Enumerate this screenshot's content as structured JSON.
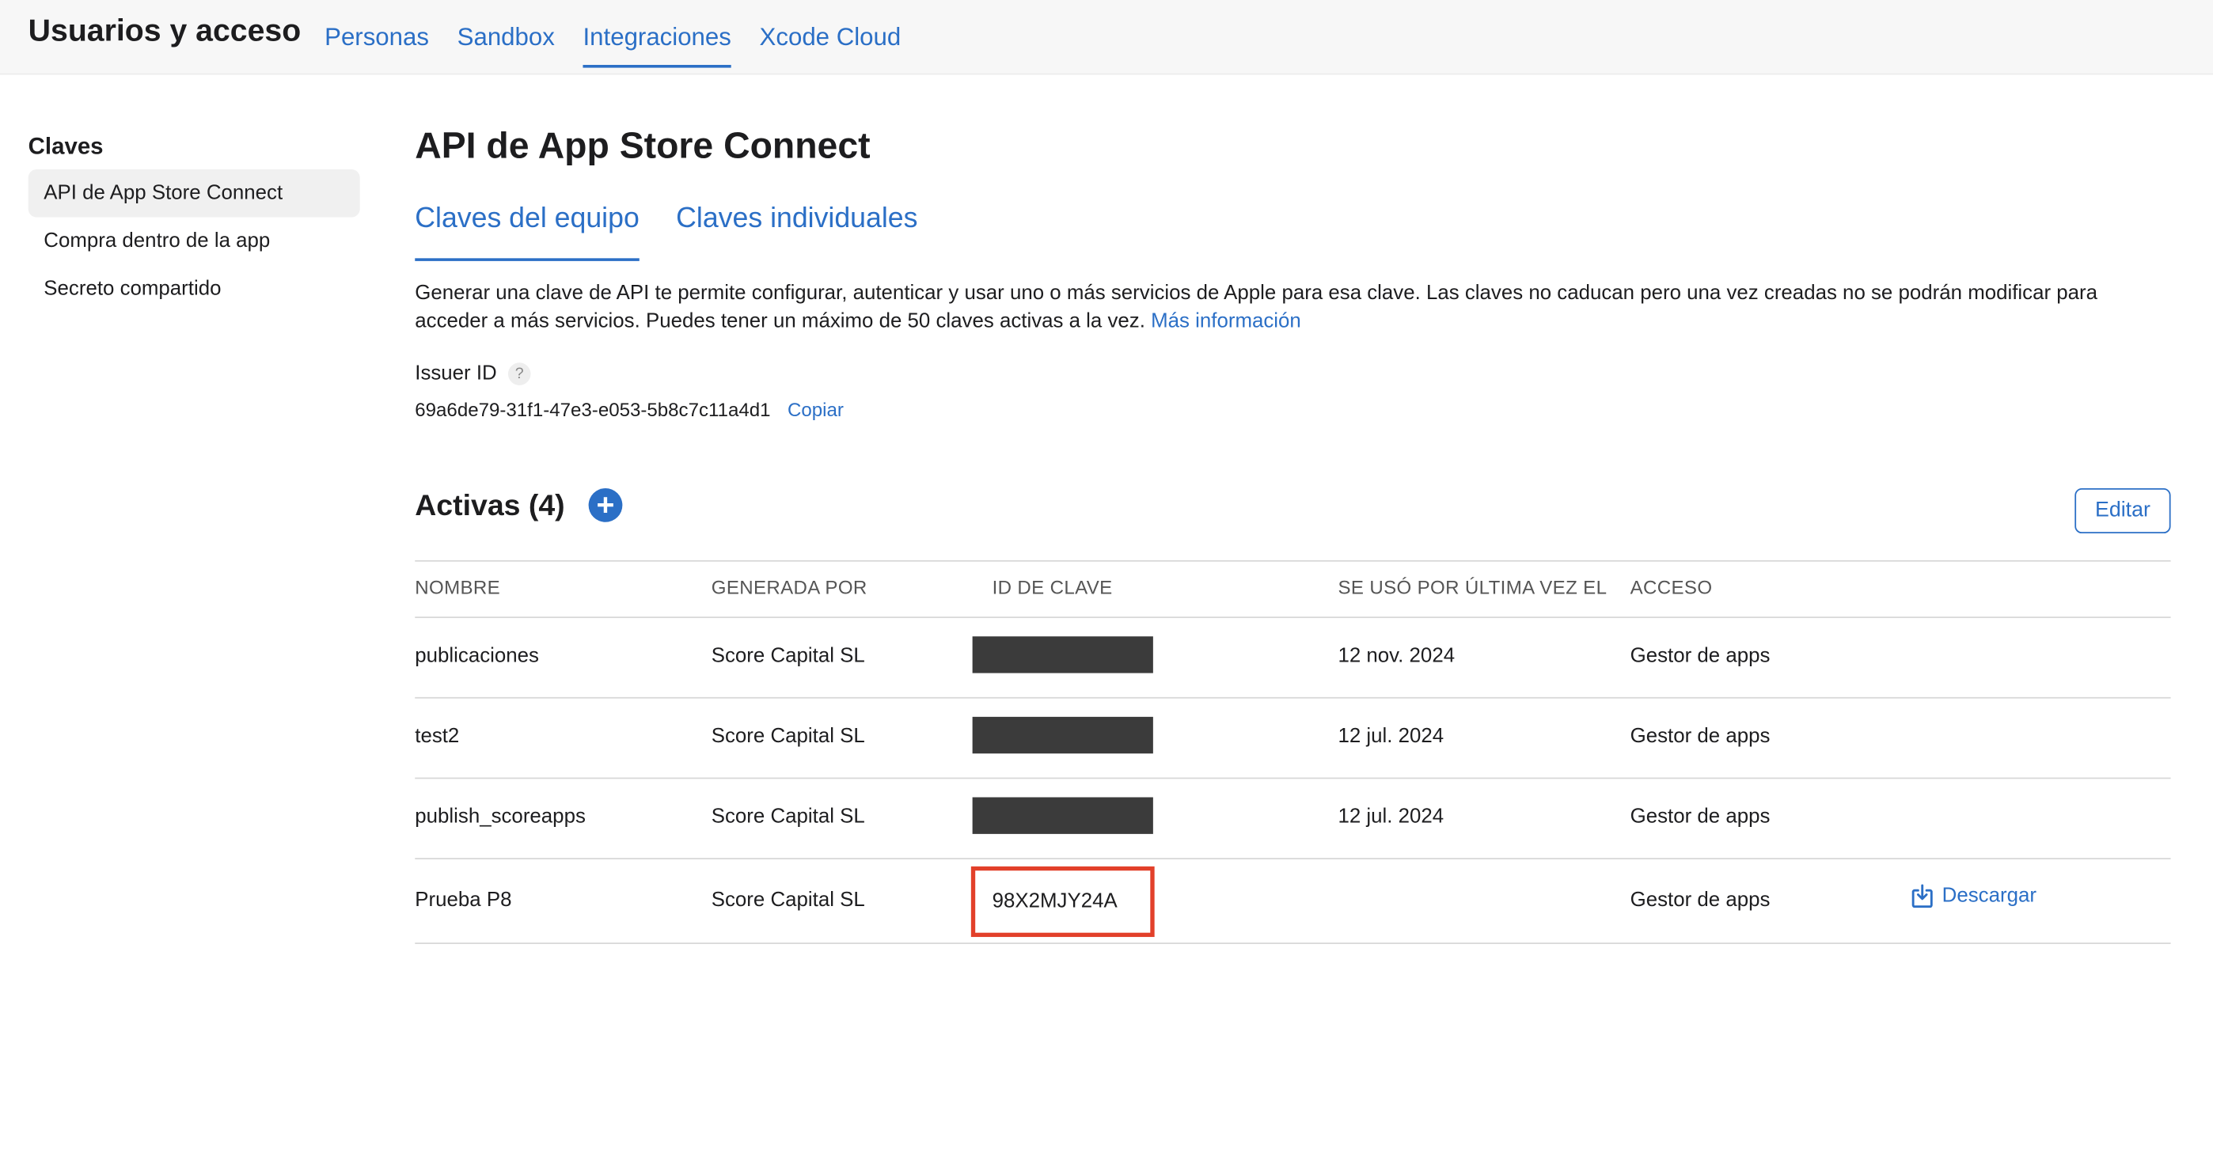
{
  "header": {
    "title": "Usuarios y acceso",
    "tabs": [
      {
        "label": "Personas",
        "active": false
      },
      {
        "label": "Sandbox",
        "active": false
      },
      {
        "label": "Integraciones",
        "active": true
      },
      {
        "label": "Xcode Cloud",
        "active": false
      }
    ]
  },
  "sidebar": {
    "heading": "Claves",
    "items": [
      {
        "label": "API de App Store Connect",
        "active": true
      },
      {
        "label": "Compra dentro de la app",
        "active": false
      },
      {
        "label": "Secreto compartido",
        "active": false
      }
    ]
  },
  "main": {
    "title": "API de App Store Connect",
    "subtabs": [
      {
        "label": "Claves del equipo",
        "active": true
      },
      {
        "label": "Claves individuales",
        "active": false
      }
    ],
    "description": "Generar una clave de API te permite configurar, autenticar y usar uno o más servicios de Apple para esa clave. Las claves no caducan pero una vez creadas no se podrán modificar para acceder a más servicios. Puedes tener un máximo de 50 claves activas a la vez.",
    "more_info_link": "Más información",
    "issuer": {
      "label": "Issuer ID",
      "help_icon": "?",
      "value": "69a6de79-31f1-47e3-e053-5b8c7c11a4d1",
      "copy_label": "Copiar"
    },
    "active_section": {
      "title": "Activas (4)",
      "add_icon": "+",
      "edit_label": "Editar"
    },
    "table": {
      "columns": [
        "NOMBRE",
        "GENERADA POR",
        "ID DE CLAVE",
        "SE USÓ POR ÚLTIMA VEZ EL",
        "ACCESO"
      ],
      "rows": [
        {
          "name": "publicaciones",
          "generated_by": "Score Capital SL",
          "key_id": "",
          "last_used": "12 nov. 2024",
          "access": "Gestor de apps"
        },
        {
          "name": "test2",
          "generated_by": "Score Capital SL",
          "key_id": "",
          "last_used": "12 jul. 2024",
          "access": "Gestor de apps"
        },
        {
          "name": "publish_scoreapps",
          "generated_by": "Score Capital SL",
          "key_id": "",
          "last_used": "12 jul. 2024",
          "access": "Gestor de apps"
        },
        {
          "name": "Prueba P8",
          "generated_by": "Score Capital SL",
          "key_id": "98X2MJY24A",
          "last_used": "",
          "access": "Gestor de apps",
          "download_label": "Descargar"
        }
      ]
    }
  },
  "colors": {
    "accent": "#2b6fc6",
    "highlight_border": "#e2402a",
    "redaction": "#3b3b3b"
  }
}
